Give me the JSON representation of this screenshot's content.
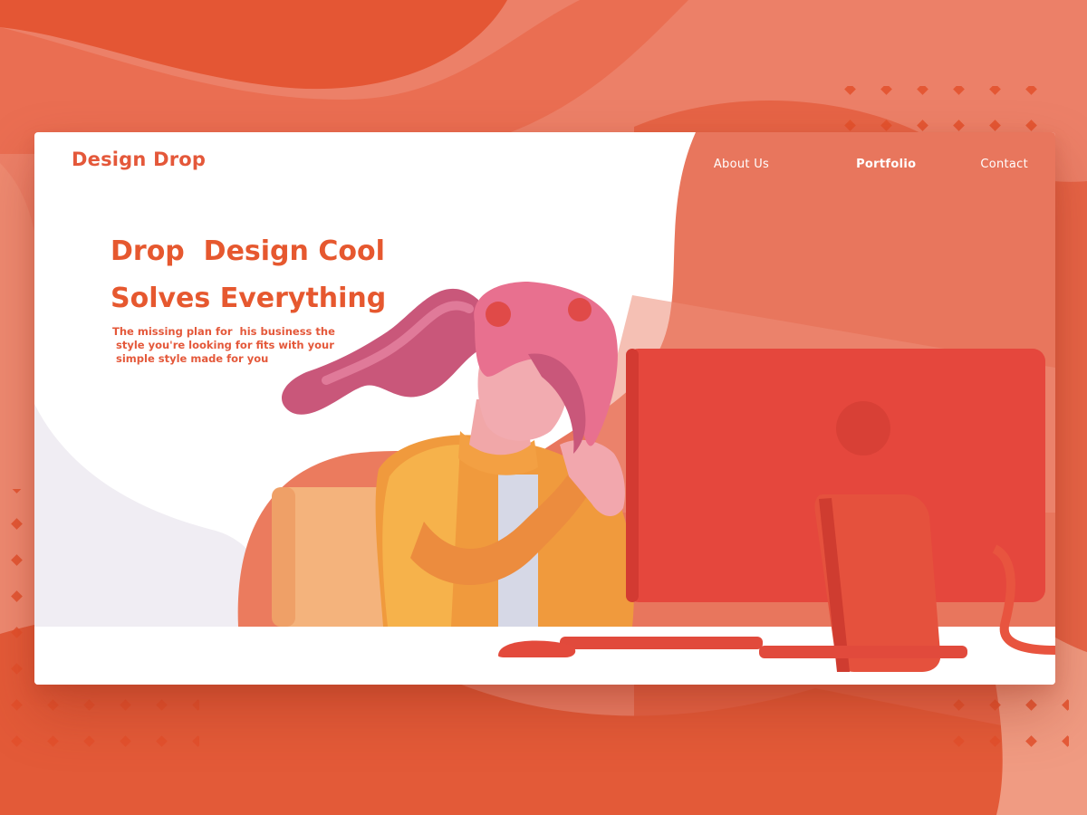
{
  "brand": {
    "name": "Design Drop"
  },
  "nav": {
    "items": [
      {
        "label": "About Us",
        "active": false
      },
      {
        "label": "Portfolio",
        "active": true
      },
      {
        "label": "Contact",
        "active": false
      }
    ]
  },
  "hero": {
    "title_line1": "Drop  Design Cool",
    "title_line2": "Solves Everything",
    "subtitle_line1": "The missing plan for  his business the",
    "subtitle_line2": " style you're looking for fits with your",
    "subtitle_line3": " simple style made for you"
  },
  "colors": {
    "accent": "#e6582f",
    "background": "#ea7a5f",
    "card": "#ffffff",
    "monitor": "#e5473d",
    "sweater": "#ef9a3c",
    "hair": "#e76b8e"
  },
  "illustration": {
    "subject": "girl-at-computer-illustration"
  }
}
